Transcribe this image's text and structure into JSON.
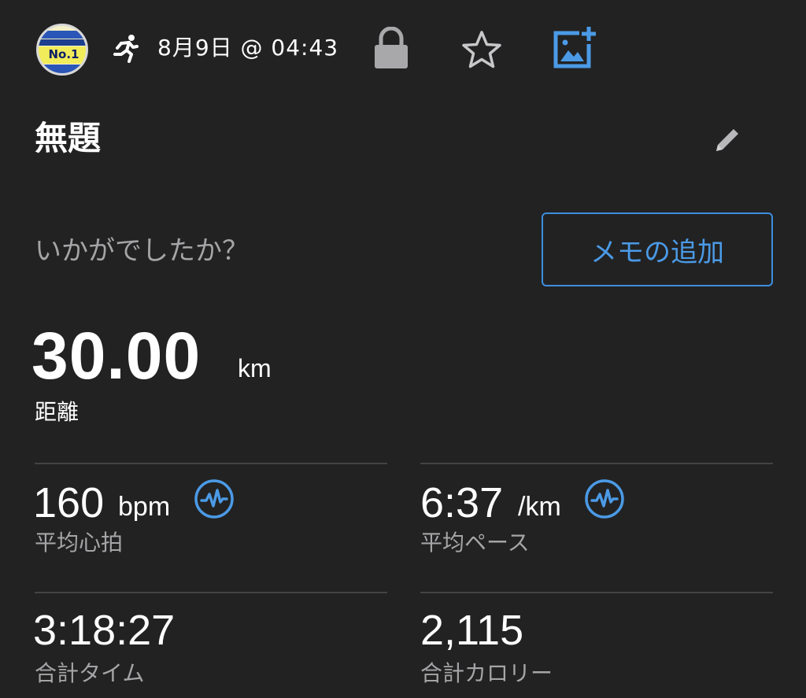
{
  "header": {
    "avatar_text": "No.1",
    "activity_icon": "running-person-icon",
    "datetime": "8月9日 @ 04:43",
    "icons": [
      "lock-icon",
      "star-icon",
      "add-photo-icon"
    ]
  },
  "activity": {
    "title": "無題",
    "prompt": "いかがでしたか？",
    "memo_button_label": "メモの追加"
  },
  "distance": {
    "value": "30.00",
    "unit": "km",
    "label": "距離"
  },
  "stats": {
    "heart_rate": {
      "value": "160",
      "unit": "bpm",
      "label": "平均心拍"
    },
    "pace": {
      "value": "6:37",
      "unit": "/km",
      "label": "平均ペース"
    },
    "time": {
      "value": "3:18:27",
      "label": "合計タイム"
    },
    "calories": {
      "value": "2,115",
      "label": "合計カロリー"
    }
  },
  "colors": {
    "background": "#222223",
    "accent": "#4b9ae6",
    "secondary_text": "#a5a5a7",
    "divider": "#444446"
  }
}
